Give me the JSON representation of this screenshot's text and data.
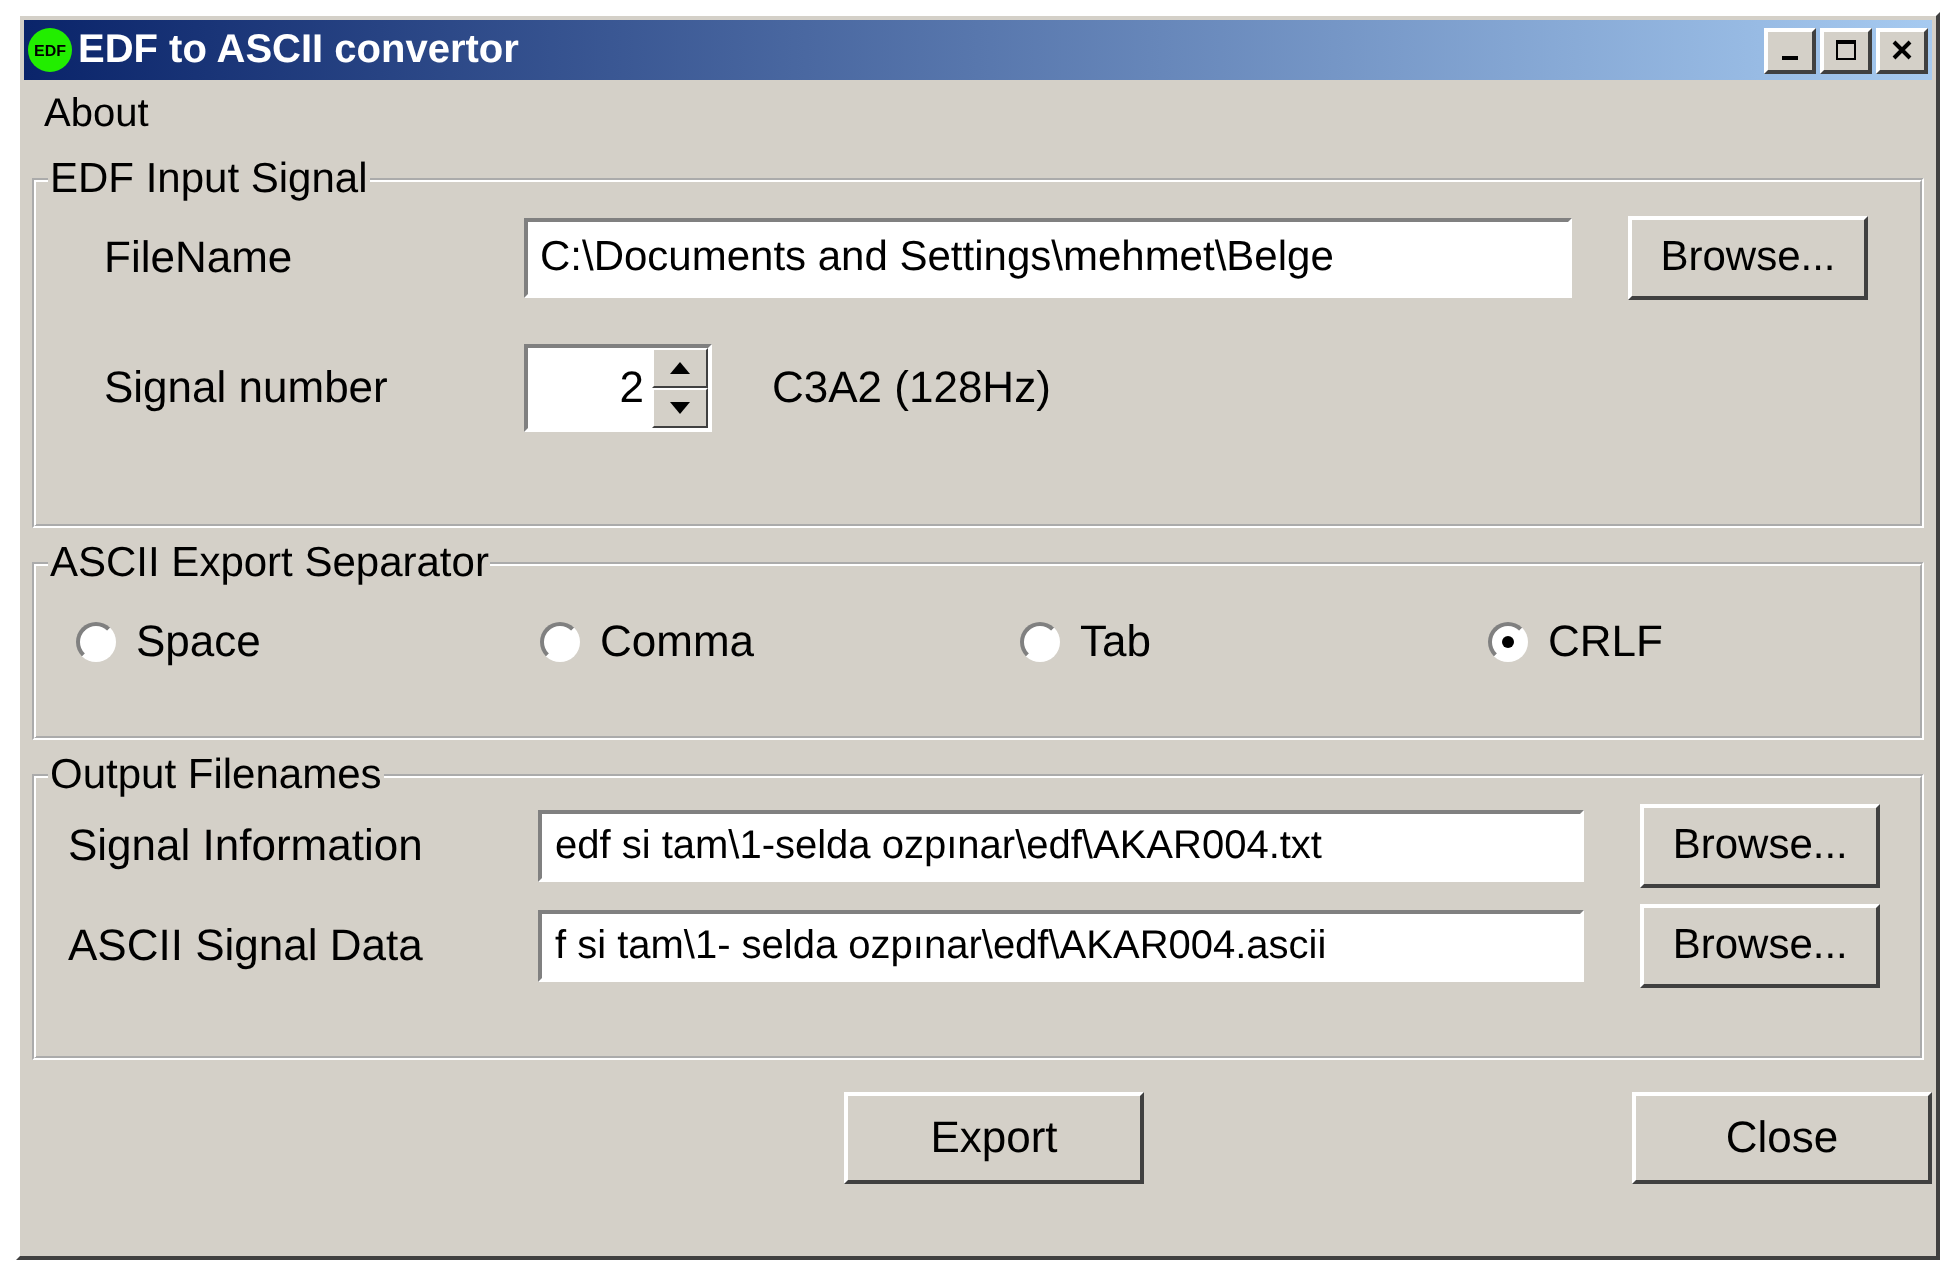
{
  "window": {
    "title": "EDF to ASCII convertor",
    "icon_text": "EDF"
  },
  "menu": [
    "About"
  ],
  "input_group": {
    "title": "EDF Input Signal",
    "filename_label": "FileName",
    "filename_value": "C:\\Documents and Settings\\mehmet\\Belge",
    "browse": "Browse...",
    "signal_label": "Signal number",
    "signal_value": "2",
    "signal_info": "C3A2 (128Hz)"
  },
  "separator_group": {
    "title": "ASCII Export Separator",
    "options": [
      {
        "label": "Space",
        "selected": false
      },
      {
        "label": "Comma",
        "selected": false
      },
      {
        "label": "Tab",
        "selected": false
      },
      {
        "label": "CRLF",
        "selected": true
      }
    ]
  },
  "output_group": {
    "title": "Output Filenames",
    "rows": [
      {
        "label": "Signal Information",
        "value": "edf si tam\\1-selda ozpınar\\edf\\AKAR004.txt",
        "browse": "Browse..."
      },
      {
        "label": "ASCII Signal Data",
        "value": "f si tam\\1- selda ozpınar\\edf\\AKAR004.ascii",
        "browse": "Browse..."
      }
    ]
  },
  "buttons": [
    "Export",
    "Close"
  ]
}
